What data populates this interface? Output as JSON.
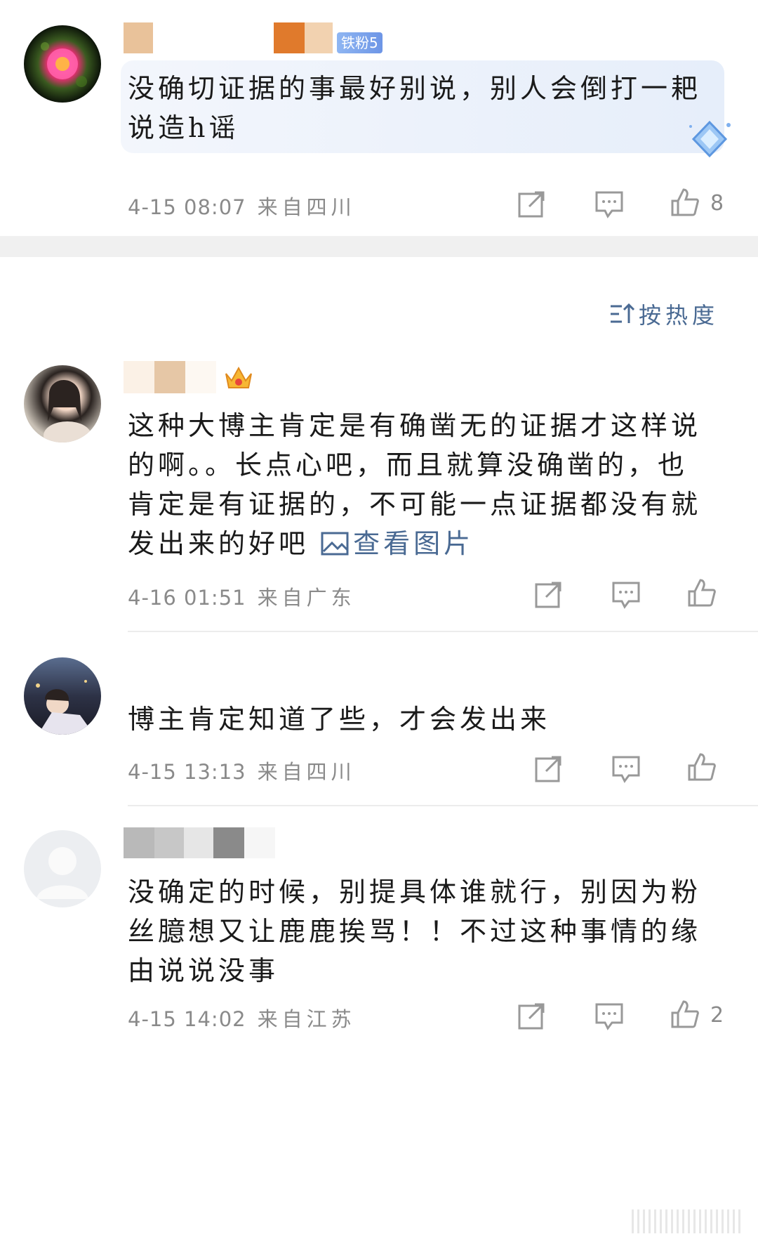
{
  "sort": {
    "label": "按热度"
  },
  "comments": [
    {
      "badge": "铁粉5",
      "text": "没确切证据的事最好别说，别人会倒打一耙说造h谣",
      "time": "4-15 08:07",
      "location": "来自四川",
      "likes": "8"
    },
    {
      "text": "这种大博主肯定是有确凿无的证据才这样说的啊。。长点心吧，而且就算没确凿的，也肯定是有证据的，不可能一点证据都没有就发出来的好吧",
      "link": "查看图片",
      "time": "4-16 01:51",
      "location": "来自广东",
      "likes": ""
    },
    {
      "text": "博主肯定知道了些，才会发出来",
      "time": "4-15 13:13",
      "location": "来自四川",
      "likes": ""
    },
    {
      "text": "没确定的时候，别提具体谁就行，别因为粉丝臆想又让鹿鹿挨骂！！不过这种事情的缘由说说没事",
      "time": "4-15 14:02",
      "location": "来自江苏",
      "likes": "2"
    }
  ],
  "icons": [
    "share-icon",
    "comment-icon",
    "like-icon",
    "image-icon",
    "sort-icon",
    "crown-icon",
    "diamond-icon"
  ],
  "colors": {
    "link": "#4a6a93",
    "meta": "#8a8a8a",
    "highlight_bg": "#eef3fb",
    "section_gap": "#f0f0f0"
  }
}
